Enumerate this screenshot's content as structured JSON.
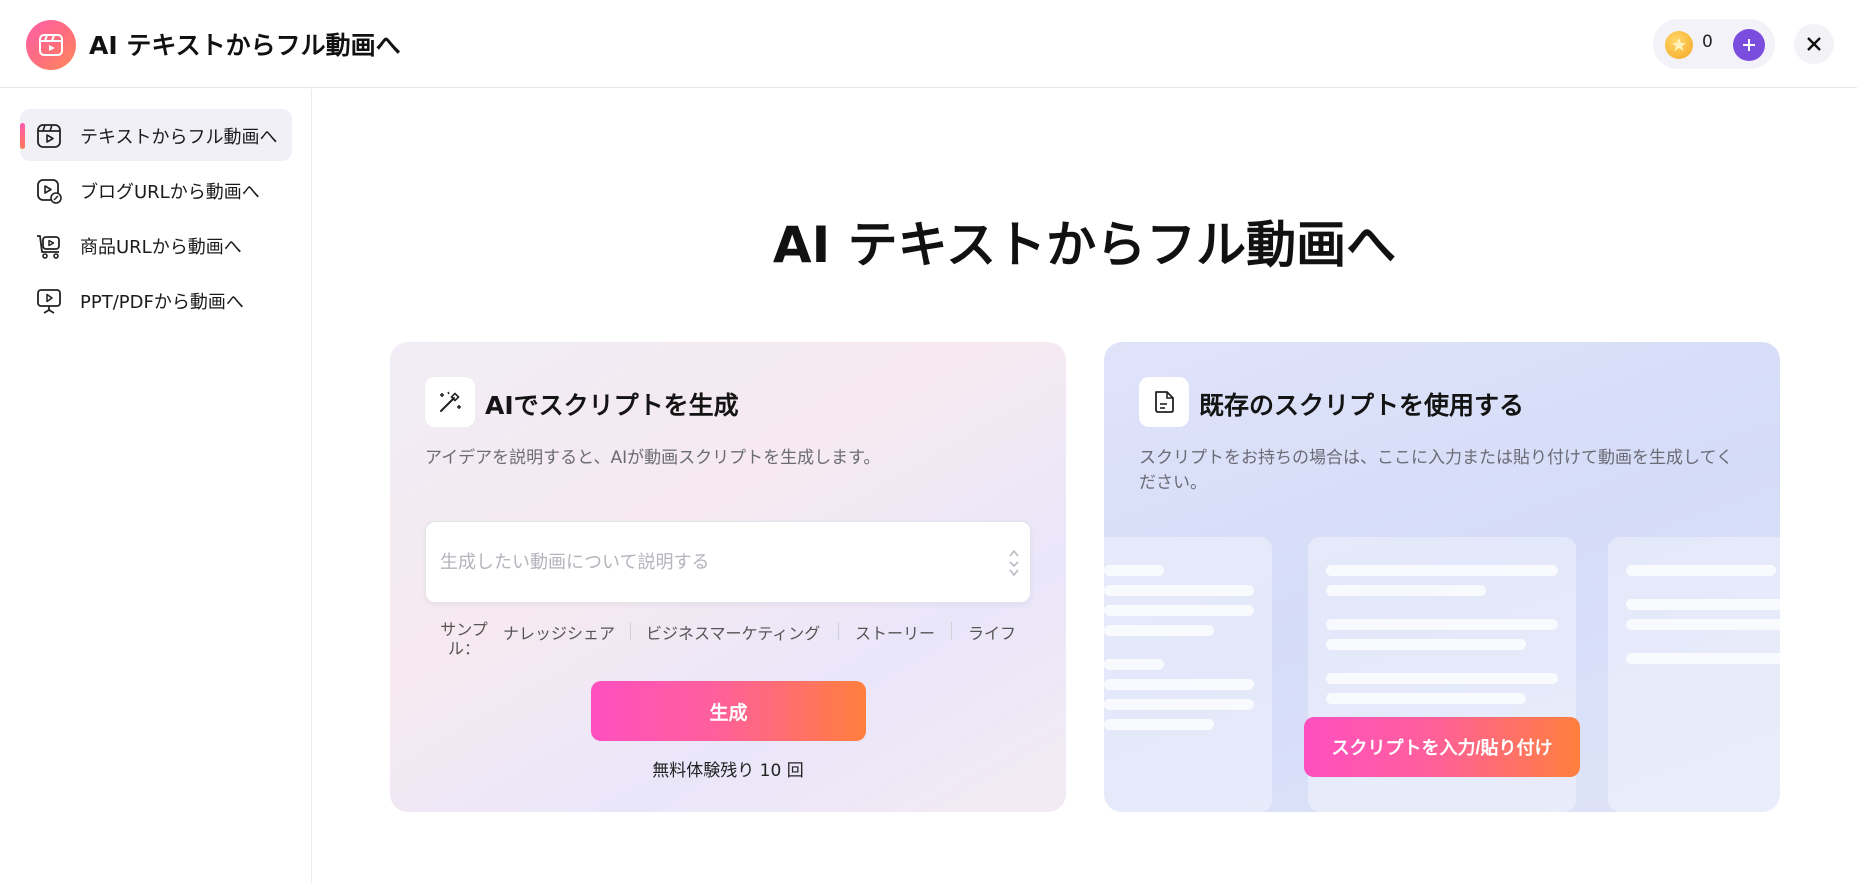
{
  "header": {
    "title": "AI テキストからフル動画へ",
    "logo_icon": "film-icon",
    "credits": "0",
    "coin_icon": "star-coin-icon",
    "add_icon": "plus-icon",
    "close_icon": "close-icon"
  },
  "sidebar": {
    "items": [
      {
        "label": "テキストからフル動画へ",
        "icon": "video-text-icon",
        "active": true
      },
      {
        "label": "ブログURLから動画へ",
        "icon": "video-link-icon",
        "active": false
      },
      {
        "label": "商品URLから動画へ",
        "icon": "cart-video-icon",
        "active": false
      },
      {
        "label": "PPT/PDFから動画へ",
        "icon": "presentation-icon",
        "active": false
      }
    ]
  },
  "main": {
    "title": "AI テキストからフル動画へ",
    "ai_card": {
      "icon": "magic-wand-icon",
      "title": "AIでスクリプトを生成",
      "description": "アイデアを説明すると、AIが動画スクリプトを生成します。",
      "placeholder": "生成したい動画について説明する",
      "value": "",
      "samples_label": "サンプル：",
      "samples": [
        "ナレッジシェア",
        "ビジネスマーケティング",
        "ストーリー",
        "ライフ"
      ],
      "generate_label": "生成",
      "quota": "無料体験残り 10 回"
    },
    "script_card": {
      "icon": "document-icon",
      "title": "既存のスクリプトを使用する",
      "description": "スクリプトをお持ちの場合は、ここに入力または貼り付けて動画を生成してください。",
      "paste_label": "スクリプトを入力/貼り付け"
    }
  },
  "colors": {
    "accent_gradient_start": "#ff4fc0",
    "accent_gradient_end": "#ff7f3d",
    "add_credit": "#7b4dde"
  }
}
